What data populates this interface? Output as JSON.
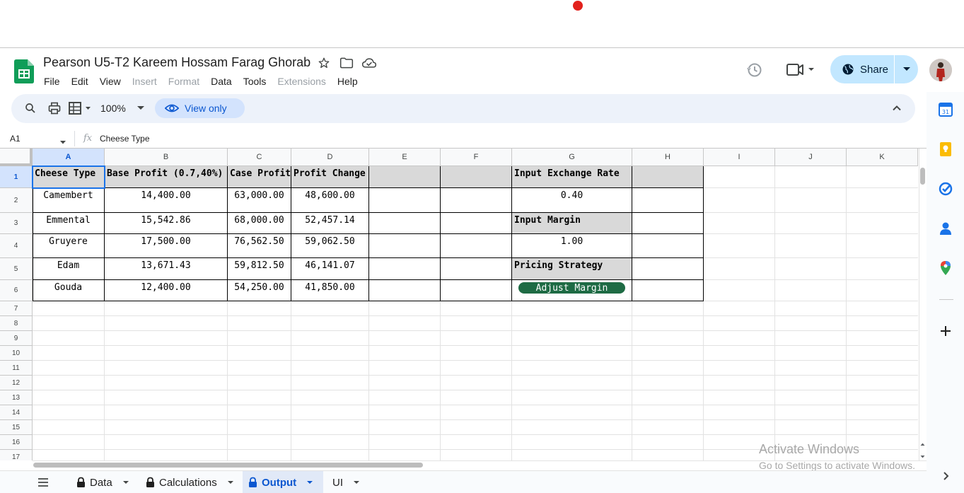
{
  "document": {
    "title": "Pearson U5-T2 Kareem Hossam Farag Ghorab"
  },
  "menu": [
    "File",
    "Edit",
    "View",
    "Insert",
    "Format",
    "Data",
    "Tools",
    "Extensions",
    "Help"
  ],
  "menu_disabled": [
    false,
    false,
    false,
    true,
    true,
    false,
    false,
    true,
    false
  ],
  "share": {
    "label": "Share"
  },
  "toolbar": {
    "zoom": "100%",
    "view_only": "View only"
  },
  "formula_bar": {
    "cell_ref": "A1",
    "content": "Cheese Type"
  },
  "columns": [
    "A",
    "B",
    "C",
    "D",
    "E",
    "F",
    "G",
    "H",
    "I",
    "J",
    "K"
  ],
  "rows": [
    "1",
    "2",
    "3",
    "4",
    "5",
    "6",
    "7",
    "8",
    "9",
    "10",
    "11",
    "12",
    "13",
    "14",
    "15",
    "16",
    "17"
  ],
  "table": {
    "headers": [
      "Cheese Type",
      "Base Profit (0.7,40%)",
      "Case Profit",
      "Profit Change"
    ],
    "rows": [
      [
        "Camembert",
        "14,400.00",
        "63,000.00",
        "48,600.00"
      ],
      [
        "Emmental",
        "15,542.86",
        "68,000.00",
        "52,457.14"
      ],
      [
        "Gruyere",
        "17,500.00",
        "76,562.50",
        "59,062.50"
      ],
      [
        "Edam",
        "13,671.43",
        "59,812.50",
        "46,141.07"
      ],
      [
        "Gouda",
        "12,400.00",
        "54,250.00",
        "41,850.00"
      ]
    ]
  },
  "inputs": {
    "exchange_rate_label": "Input Exchange Rate",
    "exchange_rate_value": "0.40",
    "margin_label": "Input Margin",
    "margin_value": "1.00",
    "pricing_label": "Pricing Strategy",
    "pricing_button": "Adjust Margin"
  },
  "sheets": [
    {
      "name": "Data",
      "locked": true,
      "active": false
    },
    {
      "name": "Calculations",
      "locked": true,
      "active": false
    },
    {
      "name": "Output",
      "locked": true,
      "active": true
    },
    {
      "name": "UI",
      "locked": false,
      "active": false
    }
  ],
  "watermark": {
    "line1": "Activate Windows",
    "line2": "Go to Settings to activate Windows."
  },
  "colors": {
    "accent": "#0b57d0",
    "share_bg": "#c2e7ff",
    "header_fill": "#d9d9d9",
    "button_green": "#1e6b44",
    "sheets_green": "#0f9d58"
  }
}
